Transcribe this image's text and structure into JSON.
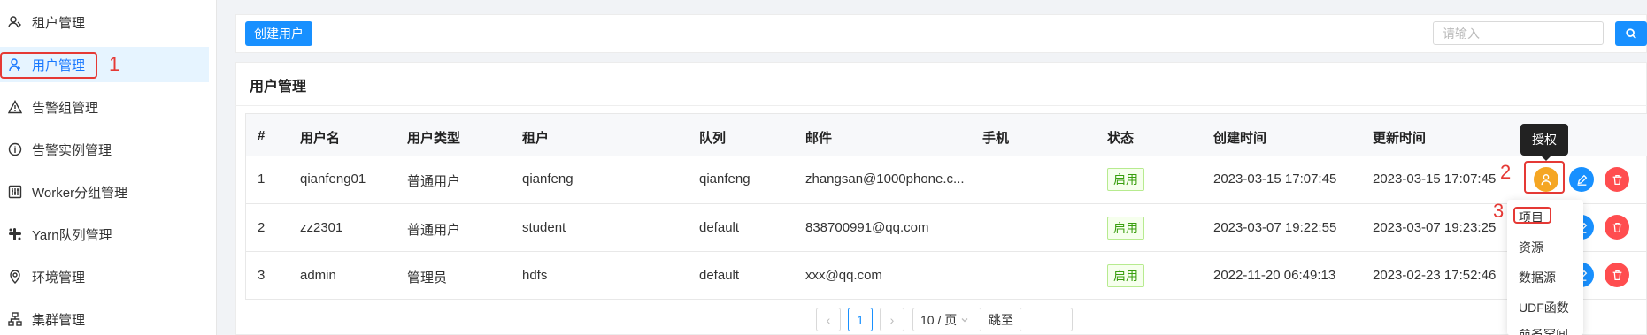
{
  "sidebar": {
    "items": [
      {
        "label": "租户管理",
        "icon": "tenant-icon"
      },
      {
        "label": "用户管理",
        "icon": "user-icon"
      },
      {
        "label": "告警组管理",
        "icon": "warning-icon"
      },
      {
        "label": "告警实例管理",
        "icon": "info-icon"
      },
      {
        "label": "Worker分组管理",
        "icon": "worker-group-icon"
      },
      {
        "label": "Yarn队列管理",
        "icon": "queue-icon"
      },
      {
        "label": "环境管理",
        "icon": "location-icon"
      },
      {
        "label": "集群管理",
        "icon": "cluster-icon"
      }
    ]
  },
  "annotations": {
    "n1": "1",
    "n2": "2",
    "n3": "3"
  },
  "toolbar": {
    "create_label": "创建用户",
    "search_placeholder": "请输入"
  },
  "main": {
    "title": "用户管理",
    "columns": [
      "#",
      "用户名",
      "用户类型",
      "租户",
      "队列",
      "邮件",
      "手机",
      "状态",
      "创建时间",
      "更新时间"
    ],
    "rows": [
      {
        "idx": "1",
        "username": "qianfeng01",
        "type": "普通用户",
        "tenant": "qianfeng",
        "queue": "qianfeng",
        "email": "zhangsan@1000phone.c...",
        "phone": "",
        "status": "启用",
        "created": "2023-03-15 17:07:45",
        "updated": "2023-03-15 17:07:45"
      },
      {
        "idx": "2",
        "username": "zz2301",
        "type": "普通用户",
        "tenant": "student",
        "queue": "default",
        "email": "838700991@qq.com",
        "phone": "",
        "status": "启用",
        "created": "2023-03-07 19:22:55",
        "updated": "2023-03-07 19:23:25"
      },
      {
        "idx": "3",
        "username": "admin",
        "type": "管理员",
        "tenant": "hdfs",
        "queue": "default",
        "email": "xxx@qq.com",
        "phone": "",
        "status": "启用",
        "created": "2022-11-20 06:49:13",
        "updated": "2023-02-23 17:52:46"
      }
    ],
    "tooltip": "授权",
    "auth_menu": [
      "项目",
      "资源",
      "数据源",
      "UDF函数",
      "命名空间"
    ]
  },
  "pagination": {
    "prev": "‹",
    "current": "1",
    "next": "›",
    "page_size": "10 / 页",
    "jump_label": "跳至"
  },
  "colors": {
    "primary": "#1890ff",
    "authorize": "#f5a623",
    "delete": "#ff4d4f",
    "annotation": "#e53935",
    "enabled_tag": "#389e0d"
  }
}
